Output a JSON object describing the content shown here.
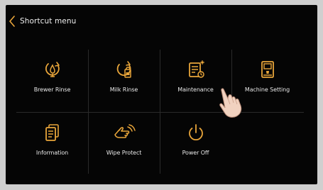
{
  "header": {
    "back_icon": "chevron-left-icon",
    "title": "Shortcut menu"
  },
  "accent_color": "#e8a53a",
  "menu": [
    {
      "label": "Brewer Rinse",
      "icon": "brewer-rinse-icon"
    },
    {
      "label": "Milk Rinse",
      "icon": "milk-rinse-icon"
    },
    {
      "label": "Maintenance",
      "icon": "maintenance-icon"
    },
    {
      "label": "Machine Setting",
      "icon": "machine-setting-icon"
    },
    {
      "label": "Information",
      "icon": "information-icon"
    },
    {
      "label": "Wipe Protect",
      "icon": "wipe-protect-icon"
    },
    {
      "label": "Power Off",
      "icon": "power-icon"
    }
  ]
}
